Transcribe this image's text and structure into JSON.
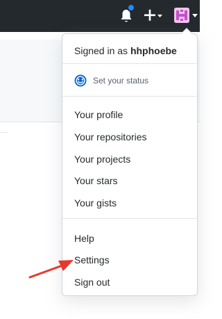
{
  "account_menu": {
    "signed_in_prefix": "Signed in as",
    "username": "hhphoebe",
    "status_label": "Set your status",
    "profile_items": [
      "Your profile",
      "Your repositories",
      "Your projects",
      "Your stars",
      "Your gists"
    ],
    "help": "Help",
    "settings": "Settings",
    "sign_out": "Sign out"
  },
  "icons": {
    "notification": "bell-icon",
    "create": "plus-icon",
    "status": "smiley-icon"
  },
  "colors": {
    "header_bg": "#24292e",
    "notification_dot": "#2188ff",
    "status_icon": "#0366d6",
    "annotation_arrow": "#e8382b"
  }
}
